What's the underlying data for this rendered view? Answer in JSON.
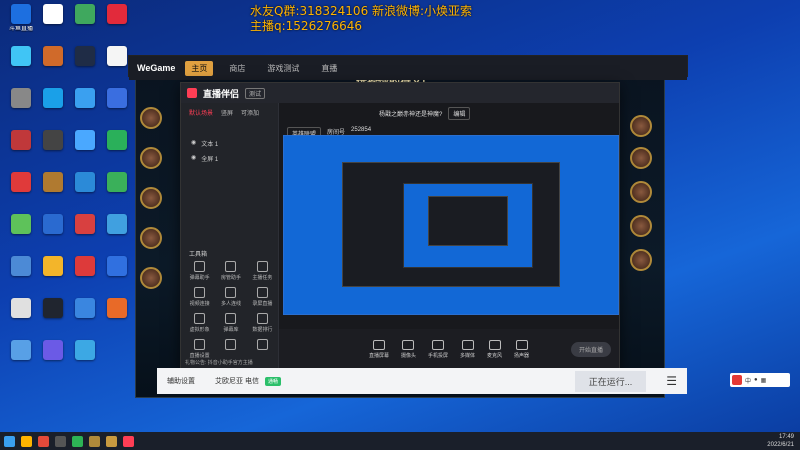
{
  "overlay": {
    "line1": "水友Q群:318324106 新浪微博:小焕亚索",
    "line2": "主播q:1526276646"
  },
  "desktop_icons": [
    {
      "label": "斗鱼直播",
      "color": "#1d6fe0"
    },
    {
      "label": "",
      "color": "#ffffff"
    },
    {
      "label": "",
      "color": "#3fa85e"
    },
    {
      "label": "",
      "color": "#e22a3b"
    },
    {
      "label": "",
      "color": "#40c5f5"
    },
    {
      "label": "",
      "color": "#d06a2a"
    },
    {
      "label": "",
      "color": "#1f2c46"
    },
    {
      "label": "",
      "color": "#f5f5f5"
    },
    {
      "label": "",
      "color": "#888888"
    },
    {
      "label": "",
      "color": "#1aa0e8"
    },
    {
      "label": "",
      "color": "#3aa0f0"
    },
    {
      "label": "",
      "color": "#3a6ee0"
    },
    {
      "label": "",
      "color": "#c0383a"
    },
    {
      "label": "",
      "color": "#444444"
    },
    {
      "label": "",
      "color": "#4aa8ff"
    },
    {
      "label": "",
      "color": "#2ab05a"
    },
    {
      "label": "",
      "color": "#e03a3a"
    },
    {
      "label": "",
      "color": "#b07a30"
    },
    {
      "label": "",
      "color": "#2b8ad8"
    },
    {
      "label": "",
      "color": "#3ab05a"
    },
    {
      "label": "",
      "color": "#5ec25a"
    },
    {
      "label": "",
      "color": "#2a6ad0"
    },
    {
      "label": "",
      "color": "#d84040"
    },
    {
      "label": "",
      "color": "#40a0e0"
    },
    {
      "label": "",
      "color": "#4c8ad6"
    },
    {
      "label": "",
      "color": "#f3b52a"
    },
    {
      "label": "",
      "color": "#dd3a3a"
    },
    {
      "label": "",
      "color": "#3070e0"
    },
    {
      "label": "",
      "color": "#e0e0e0"
    },
    {
      "label": "",
      "color": "#20252f"
    },
    {
      "label": "",
      "color": "#3a86e0"
    },
    {
      "label": "",
      "color": "#e86a28"
    },
    {
      "label": "",
      "color": "#58a0e6"
    },
    {
      "label": "",
      "color": "#6b5ae6"
    },
    {
      "label": "",
      "color": "#3ca8e4"
    }
  ],
  "wegame": {
    "logo": "WeGame",
    "tabs": [
      "主页",
      "商店",
      "游戏测试",
      "直播"
    ],
    "bottom_settings": "辅助设置",
    "game_name": "艾欧尼亚 电信",
    "status_badge": "通畅",
    "running": "正在运行..."
  },
  "lol": {
    "title": "选择你的符文!"
  },
  "stream_app": {
    "name": "直播伴侣",
    "version": "测试",
    "scene_tabs": [
      "默认场景",
      "竖屏",
      "可添加"
    ],
    "sources": [
      "文本 1",
      "全屏 1"
    ],
    "topic": "杨戬之巅赤神还是神魔?",
    "topic_tag": "编辑",
    "category": "英雄联盟",
    "id_label": "房间号",
    "room": "252854",
    "tools_title": "工具箱",
    "tools": [
      "弹幕助手",
      "房管助手",
      "主播任务",
      "视频连接",
      "多人连线",
      "录屏直播",
      "虚拟形象",
      "弹幕库",
      "数据排行",
      "直播设置",
      "",
      ""
    ],
    "bottom_actions": [
      "直播屏幕",
      "摄像头",
      "手机投屏",
      "多媒体",
      "麦克风",
      "扬声器"
    ],
    "go_live": "开始直播",
    "footer_note": "礼物公告: 抖音小助手官方主播",
    "footer_user": "主播小焕"
  },
  "taskbar": {
    "time": "17:49",
    "date": "2022/6/21"
  },
  "ime": {
    "label": "中"
  }
}
